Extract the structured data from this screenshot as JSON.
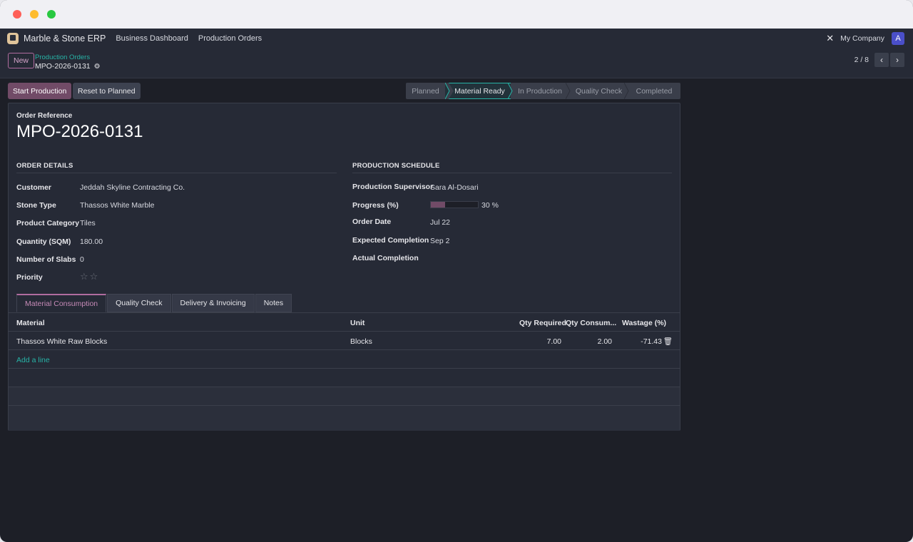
{
  "navbar": {
    "app_name": "Marble & Stone ERP",
    "links": [
      "Business Dashboard",
      "Production Orders"
    ],
    "company": "My Company",
    "avatar": "A"
  },
  "control": {
    "new_label": "New",
    "breadcrumb": "Production Orders",
    "record_name": "MPO-2026-0131",
    "pager": "2 / 8"
  },
  "actions": {
    "start": "Start Production",
    "reset": "Reset to Planned"
  },
  "stages": [
    "Planned",
    "Material Ready",
    "In Production",
    "Quality Check",
    "Completed"
  ],
  "active_stage": "Material Ready",
  "form": {
    "ref_label": "Order Reference",
    "ref_value": "MPO-2026-0131",
    "order_details_title": "ORDER DETAILS",
    "schedule_title": "PRODUCTION SCHEDULE",
    "customer_label": "Customer",
    "customer": "Jeddah Skyline Contracting Co.",
    "stone_type_label": "Stone Type",
    "stone_type": "Thassos White Marble",
    "category_label": "Product Category",
    "category": "Tiles",
    "quantity_label": "Quantity (SQM)",
    "quantity": "180.00",
    "slabs_label": "Number of Slabs",
    "slabs": "0",
    "priority_label": "Priority",
    "priority_stars": "☆☆",
    "supervisor_label": "Production Supervisor",
    "supervisor": "Sara Al-Dosari",
    "progress_label": "Progress (%)",
    "progress": 30,
    "progress_text": "30 %",
    "order_date_label": "Order Date",
    "order_date": "Jul 22",
    "expected_label": "Expected Completion",
    "expected": "Sep 2",
    "actual_label": "Actual Completion"
  },
  "tabs": [
    "Material Consumption",
    "Quality Check",
    "Delivery & Invoicing",
    "Notes"
  ],
  "table": {
    "headers": [
      "Material",
      "Unit",
      "Qty Required",
      "Qty Consum...",
      "Wastage (%)"
    ],
    "rows": [
      [
        "Thassos White Raw Blocks",
        "Blocks",
        "7.00",
        "2.00",
        "-71.43"
      ]
    ],
    "add_line": "Add a line"
  },
  "colors": {
    "accent": "#714b67",
    "link": "#27b3a6"
  }
}
